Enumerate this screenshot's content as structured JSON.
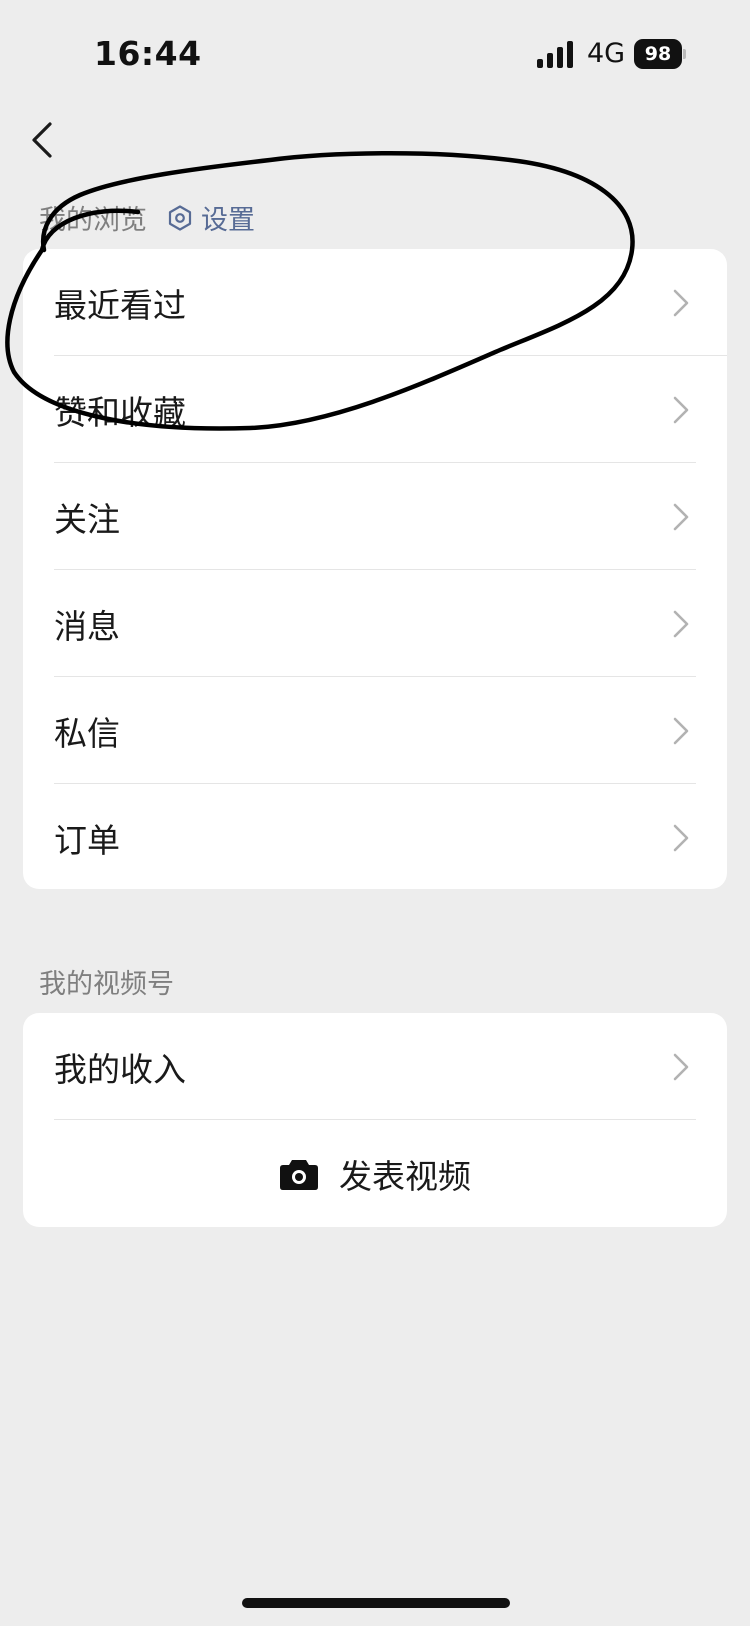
{
  "status_bar": {
    "time": "16:44",
    "network": "4G",
    "battery_level": "98"
  },
  "browse_section": {
    "title": "我的浏览",
    "settings_label": "设置",
    "items": [
      {
        "label": "最近看过"
      },
      {
        "label": "赞和收藏"
      },
      {
        "label": "关注"
      },
      {
        "label": "消息"
      },
      {
        "label": "私信"
      },
      {
        "label": "订单"
      }
    ]
  },
  "channels_section": {
    "title": "我的视频号",
    "items": [
      {
        "label": "我的收入"
      }
    ],
    "publish_label": "发表视频"
  },
  "icons": {
    "back": "chevron-left-icon",
    "settings": "hexagon-gear-icon",
    "row_arrow": "chevron-right-icon",
    "camera": "camera-icon"
  },
  "colors": {
    "background": "#ededed",
    "card": "#ffffff",
    "link_accent": "#576b95",
    "section_title": "#7f7f7f",
    "annotation_ink": "#000000"
  }
}
